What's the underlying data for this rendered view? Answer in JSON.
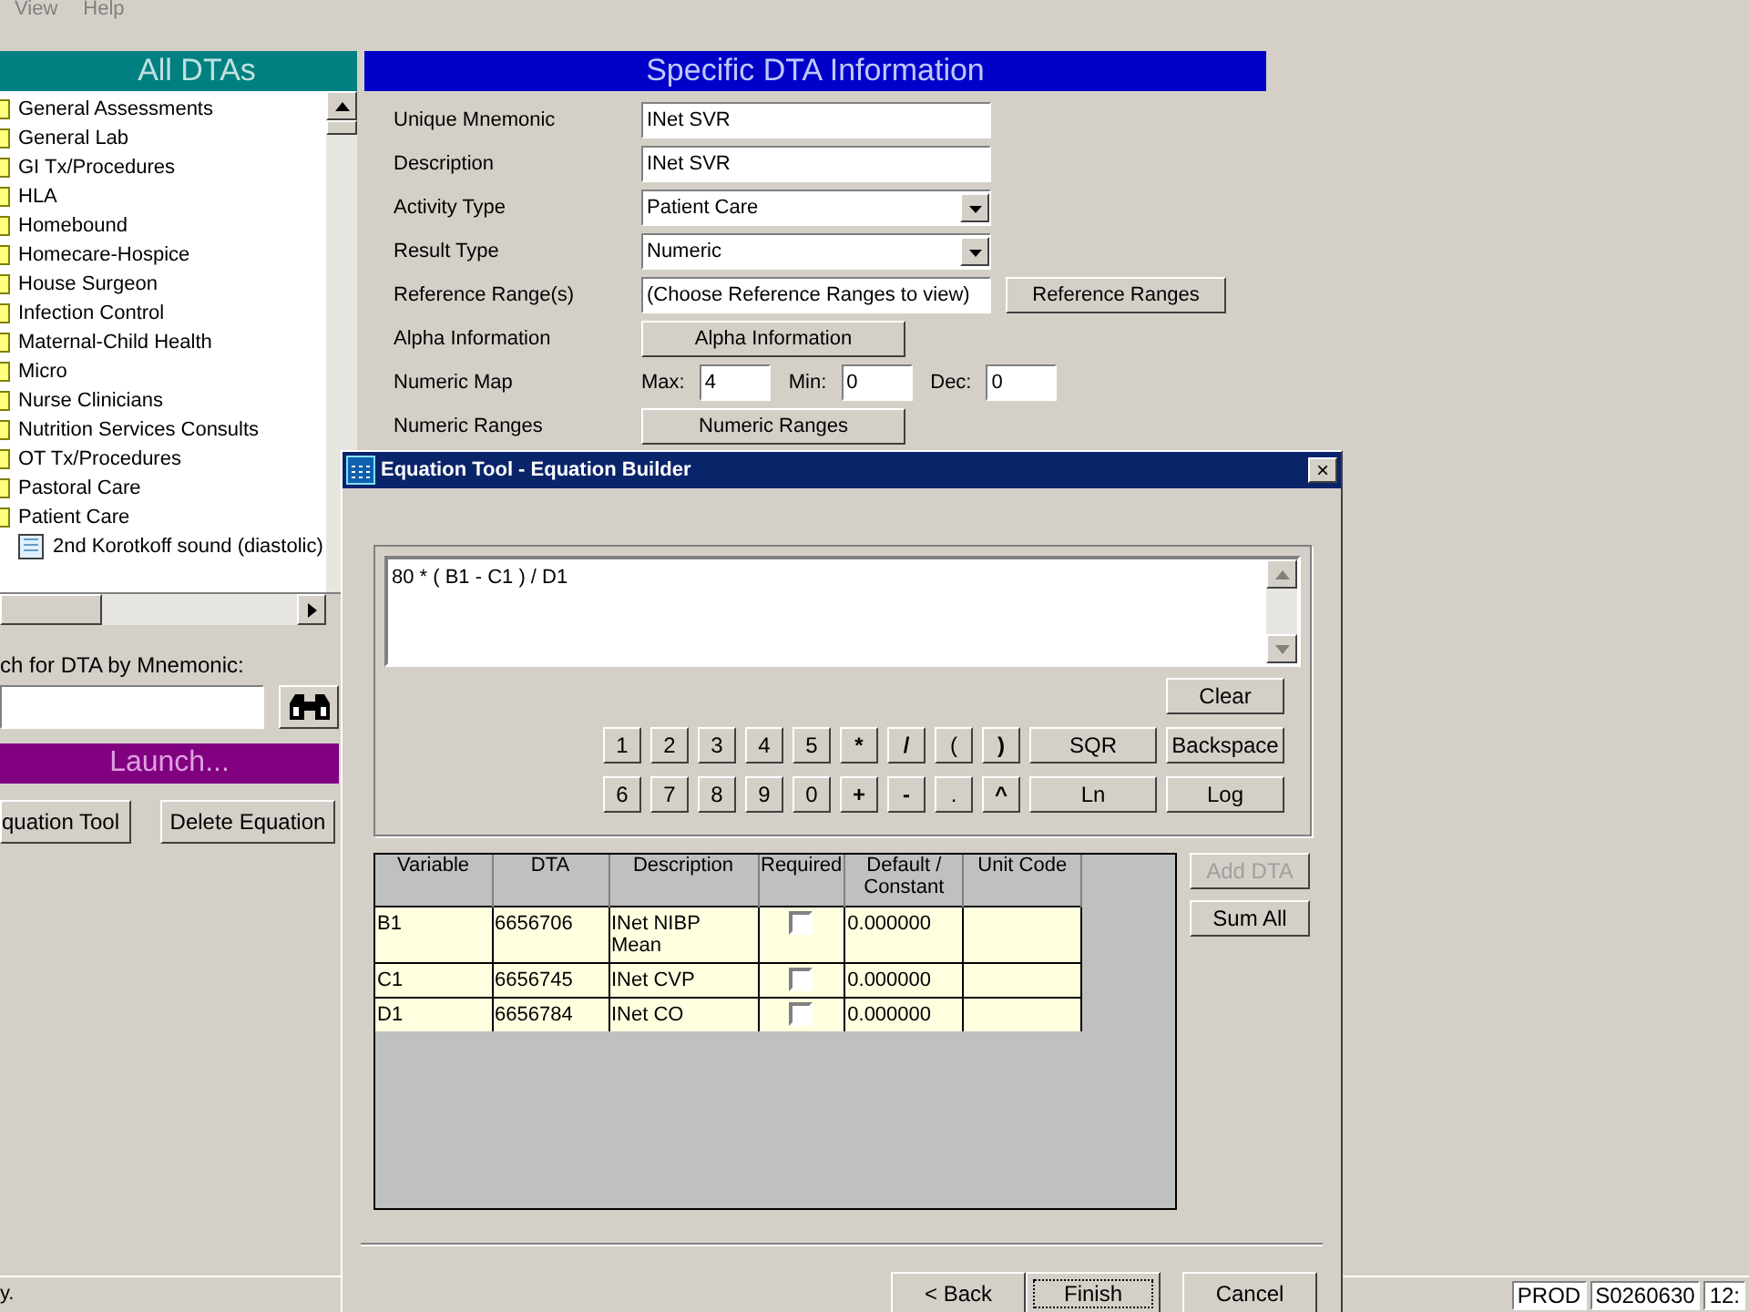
{
  "menu": [
    "View",
    "Help"
  ],
  "all_dtas": {
    "title": "All DTAs",
    "items": [
      {
        "label": "General Assessments",
        "kind": "folder"
      },
      {
        "label": "General Lab",
        "kind": "folder"
      },
      {
        "label": "GI Tx/Procedures",
        "kind": "folder"
      },
      {
        "label": "HLA",
        "kind": "folder"
      },
      {
        "label": "Homebound",
        "kind": "folder"
      },
      {
        "label": "Homecare-Hospice",
        "kind": "folder"
      },
      {
        "label": "House Surgeon",
        "kind": "folder"
      },
      {
        "label": "Infection Control",
        "kind": "folder"
      },
      {
        "label": "Maternal-Child Health",
        "kind": "folder"
      },
      {
        "label": "Micro",
        "kind": "folder"
      },
      {
        "label": "Nurse Clinicians",
        "kind": "folder"
      },
      {
        "label": "Nutrition Services Consults",
        "kind": "folder"
      },
      {
        "label": "OT Tx/Procedures",
        "kind": "folder"
      },
      {
        "label": "Pastoral Care",
        "kind": "folder"
      },
      {
        "label": "Patient Care",
        "kind": "folder",
        "children": [
          {
            "label": "2nd Korotkoff sound (diastolic)",
            "kind": "item"
          }
        ]
      }
    ]
  },
  "search": {
    "label": "ch for DTA by Mnemonic:"
  },
  "launch": {
    "title": "Launch...",
    "buttons": [
      "quation Tool",
      "Delete Equation"
    ]
  },
  "specific": {
    "title": "Specific DTA Information",
    "rows": [
      {
        "label": "Unique Mnemonic",
        "kind": "text",
        "value": "INet SVR"
      },
      {
        "label": "Description",
        "kind": "text",
        "value": "INet SVR"
      },
      {
        "label": "Activity Type",
        "kind": "select",
        "value": "Patient Care"
      },
      {
        "label": "Result Type",
        "kind": "select",
        "value": "Numeric"
      },
      {
        "label": "Reference Range(s)",
        "kind": "text_button",
        "value": "(Choose Reference Ranges to view)",
        "button": "Reference Ranges"
      },
      {
        "label": "Alpha Information",
        "kind": "button",
        "button": "Alpha Information"
      },
      {
        "label": "Numeric Map",
        "kind": "map",
        "fields": [
          {
            "label": "Max:",
            "value": "4"
          },
          {
            "label": "Min:",
            "value": "0"
          },
          {
            "label": "Dec:",
            "value": "0"
          }
        ]
      },
      {
        "label": "Numeric Ranges",
        "kind": "button",
        "button": "Numeric Ranges"
      }
    ]
  },
  "dialog": {
    "title": "Equation Tool - Equation Builder",
    "close": "×",
    "equation": "80 * ( B1 - C1 ) / D1",
    "clear": "Clear",
    "keys": [
      [
        "1",
        "2",
        "3",
        "4",
        "5",
        "*",
        "/",
        "(",
        ")",
        "SQR",
        "Backspace"
      ],
      [
        "6",
        "7",
        "8",
        "9",
        "0",
        "+",
        "-",
        ".",
        "^",
        "Ln",
        "Log"
      ]
    ],
    "table": {
      "columns": [
        "Variable",
        "DTA",
        "Description",
        "Required",
        "Default / Constant",
        "Unit Code"
      ],
      "rows": [
        {
          "variable": "B1",
          "dta": "6656706",
          "description": "INet NIBP Mean",
          "required": false,
          "default": "0.000000"
        },
        {
          "variable": "C1",
          "dta": "6656745",
          "description": "INet CVP",
          "required": false,
          "default": "0.000000"
        },
        {
          "variable": "D1",
          "dta": "6656784",
          "description": "INet CO",
          "required": false,
          "default": "0.000000"
        }
      ]
    },
    "side_buttons": [
      {
        "label": "Add DTA",
        "disabled": true
      },
      {
        "label": "Sum All",
        "disabled": false
      }
    ],
    "footer": [
      {
        "label": "< Back",
        "selected": false
      },
      {
        "label": "Finish",
        "selected": true
      },
      {
        "label": "Cancel",
        "selected": false
      }
    ]
  },
  "status_bar": {
    "message": "y.",
    "panels": [
      "PROD",
      "S0260630",
      "12:"
    ]
  }
}
